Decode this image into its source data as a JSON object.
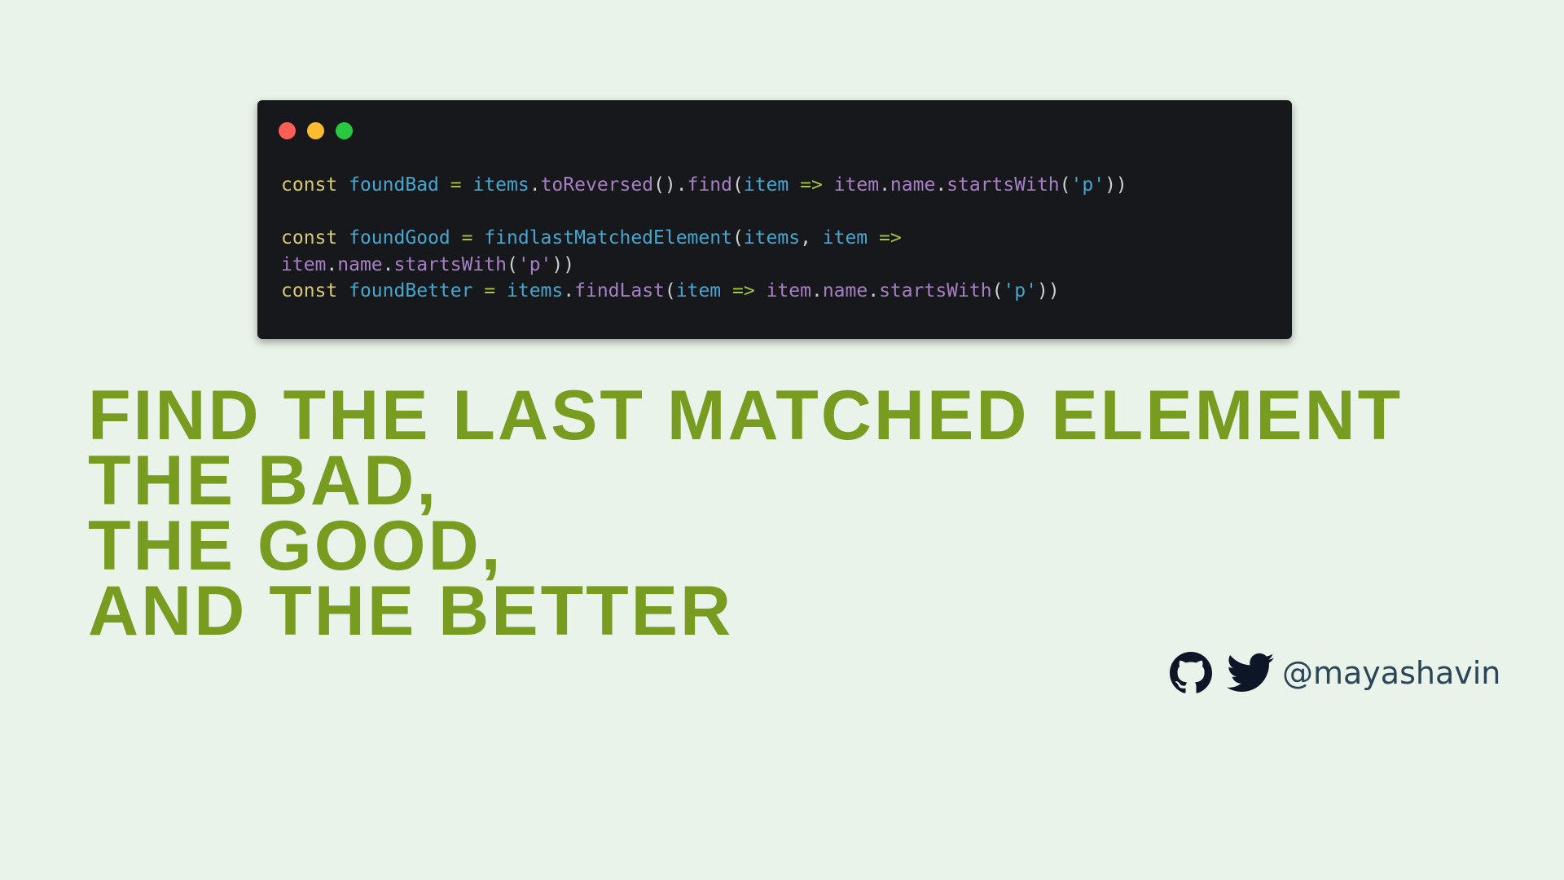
{
  "colors": {
    "background": "#e9f3e9",
    "window": "#17181b",
    "title": "#789c1f",
    "handle": "#2b4657",
    "close": "#fd5f57",
    "minimize": "#febc2e",
    "maximize": "#28c840"
  },
  "code_lines": [
    [
      [
        "const",
        "kw"
      ],
      [
        " ",
        "pu"
      ],
      [
        "foundBad",
        "id"
      ],
      [
        " ",
        "pu"
      ],
      [
        "=",
        "op"
      ],
      [
        " ",
        "pu"
      ],
      [
        "items",
        "id"
      ],
      [
        ".",
        "pu"
      ],
      [
        "toReversed",
        "fn"
      ],
      [
        "().",
        "pu"
      ],
      [
        "find",
        "fn"
      ],
      [
        "(",
        "pu"
      ],
      [
        "item",
        "id"
      ],
      [
        " ",
        "pu"
      ],
      [
        "=>",
        "op"
      ],
      [
        " ",
        "pu"
      ],
      [
        "item",
        "fn"
      ],
      [
        ".",
        "pu"
      ],
      [
        "name",
        "fn"
      ],
      [
        ".",
        "pu"
      ],
      [
        "startsWith",
        "fn"
      ],
      [
        "(",
        "pu"
      ],
      [
        "'p'",
        "str"
      ],
      [
        "))",
        "pu"
      ]
    ],
    [],
    [
      [
        "const",
        "kw"
      ],
      [
        " ",
        "pu"
      ],
      [
        "foundGood",
        "id"
      ],
      [
        " ",
        "pu"
      ],
      [
        "=",
        "op"
      ],
      [
        " ",
        "pu"
      ],
      [
        "findlastMatchedElement",
        "id"
      ],
      [
        "(",
        "pu"
      ],
      [
        "items",
        "id"
      ],
      [
        ", ",
        "pu"
      ],
      [
        "item",
        "id"
      ],
      [
        " ",
        "pu"
      ],
      [
        "=>",
        "op"
      ]
    ],
    [
      [
        "item",
        "fn"
      ],
      [
        ".",
        "pu"
      ],
      [
        "name",
        "fn"
      ],
      [
        ".",
        "pu"
      ],
      [
        "startsWith",
        "fn"
      ],
      [
        "(",
        "pu"
      ],
      [
        "'p'",
        "fn"
      ],
      [
        "))",
        "pu"
      ]
    ],
    [
      [
        "const",
        "kw"
      ],
      [
        " ",
        "pu"
      ],
      [
        "foundBetter",
        "id"
      ],
      [
        " ",
        "pu"
      ],
      [
        "=",
        "op"
      ],
      [
        " ",
        "pu"
      ],
      [
        "items",
        "id"
      ],
      [
        ".",
        "pu"
      ],
      [
        "findLast",
        "fn"
      ],
      [
        "(",
        "pu"
      ],
      [
        "item",
        "id"
      ],
      [
        " ",
        "pu"
      ],
      [
        "=>",
        "op"
      ],
      [
        " ",
        "pu"
      ],
      [
        "item",
        "fn"
      ],
      [
        ".",
        "pu"
      ],
      [
        "name",
        "fn"
      ],
      [
        ".",
        "pu"
      ],
      [
        "startsWith",
        "fn"
      ],
      [
        "(",
        "pu"
      ],
      [
        "'p'",
        "str"
      ],
      [
        "))",
        "pu"
      ]
    ]
  ],
  "title_lines": [
    "FIND THE LAST MATCHED ELEMENT",
    "THE BAD,",
    "THE GOOD,",
    "AND THE BETTER"
  ],
  "social": {
    "icons": [
      "github-icon",
      "twitter-icon"
    ],
    "handle": "@mayashavin"
  }
}
